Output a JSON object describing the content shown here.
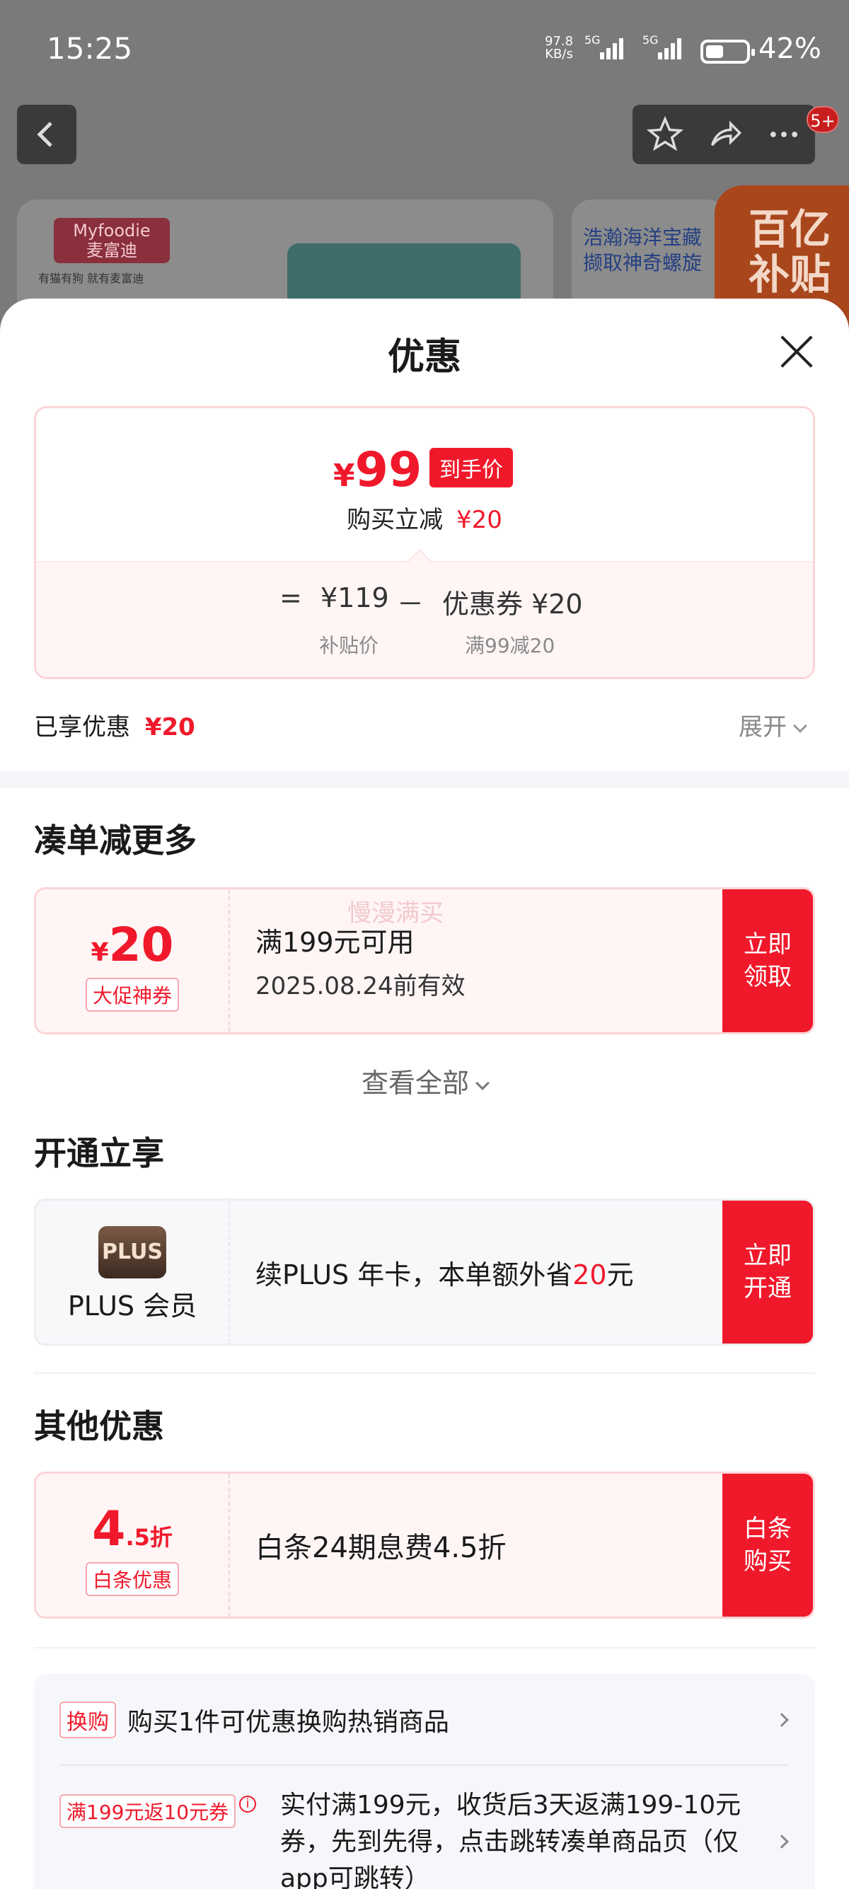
{
  "status_bar": {
    "time": "15:25",
    "net_speed_value": "97.8",
    "net_speed_unit": "KB/s",
    "sim1": "5G",
    "sim2": "5G",
    "battery": "42%"
  },
  "background": {
    "badge_count": "5+",
    "brand_logo_text": "Myfoodie",
    "brand_logo_sub": "麦富迪",
    "brand_slogan": "有猫有狗 就有麦富迪",
    "promo_line1": "浩瀚海洋宝藏",
    "promo_line2": "撷取神奇螺旋",
    "banner_line1": "百亿",
    "banner_line2": "补贴"
  },
  "sheet": {
    "title": "优惠",
    "price": {
      "symbol": "¥",
      "value": "99",
      "tag": "到手价",
      "reduce_label": "购买立减",
      "reduce_value": "¥20",
      "equals": "=",
      "subsidy_price": "¥119",
      "minus": "－",
      "coupon_label": "优惠券 ¥20",
      "subsidy_note": "补贴价",
      "coupon_note": "满99减20"
    },
    "enjoyed_label": "已享优惠",
    "enjoyed_value": "¥20",
    "expand_label": "展开"
  },
  "section_more": {
    "title": "凑单减更多",
    "watermark": "慢漫满买",
    "coupon": {
      "symbol": "¥",
      "amount": "20",
      "badge": "大促神券",
      "condition": "满199元可用",
      "valid": "2025.08.24前有效",
      "button": "立即领取"
    },
    "view_all": "查看全部"
  },
  "section_plus": {
    "title": "开通立享",
    "icon_text": "PLUS",
    "member_label": "PLUS 会员",
    "desc_before": "续PLUS 年卡，本单额外省",
    "desc_amount": "20",
    "desc_after": "元",
    "button": "立即开通"
  },
  "section_other": {
    "title": "其他优惠",
    "discount_big": "4",
    "discount_small": ".5折",
    "badge": "白条优惠",
    "desc": "白条24期息费4.5折",
    "button": "白条购买"
  },
  "extra_rows": [
    {
      "tag": "换购",
      "text": "购买1件可优惠换购热销商品"
    },
    {
      "tag": "满199元返10元券",
      "text": "实付满199元，收货后3天返满199-10元券，先到先得，点击跳转凑单商品页（仅app可跳转）"
    }
  ],
  "colors": {
    "accent": "#f0192b",
    "tint": "#fff5f5"
  }
}
